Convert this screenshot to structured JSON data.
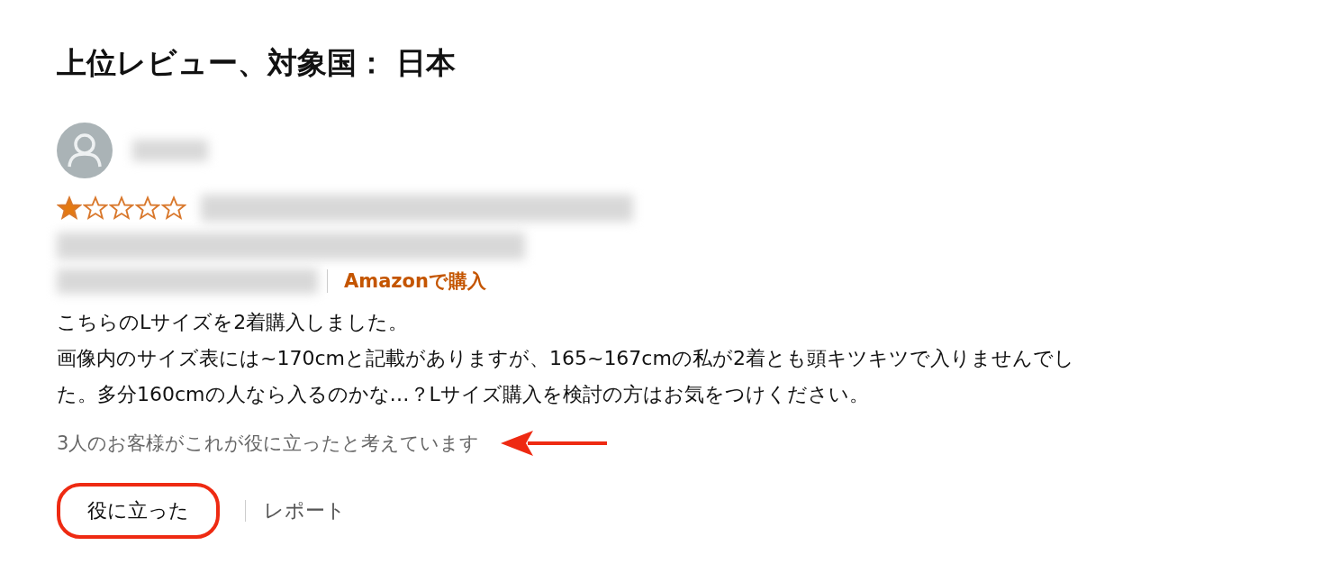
{
  "heading": "上位レビュー、対象国： 日本",
  "review": {
    "reviewer": {
      "name_redacted": true
    },
    "stars": 1,
    "title_redacted": true,
    "meta_redacted": true,
    "badge": "Amazonで購入",
    "body": [
      "こちらのLサイズを2着購入しました。",
      "画像内のサイズ表には~170cmと記載がありますが、165~167cmの私が2着とも頭キツキツで入りませんでした。多分160cmの人なら入るのかな…？Lサイズ購入を検討の方はお気をつけください。"
    ],
    "helpful_count": "3人のお客様がこれが役に立ったと考えています",
    "helpful_button": "役に立った",
    "report_link": "レポート",
    "arrow_annotation": true,
    "ring_annotation": true
  }
}
